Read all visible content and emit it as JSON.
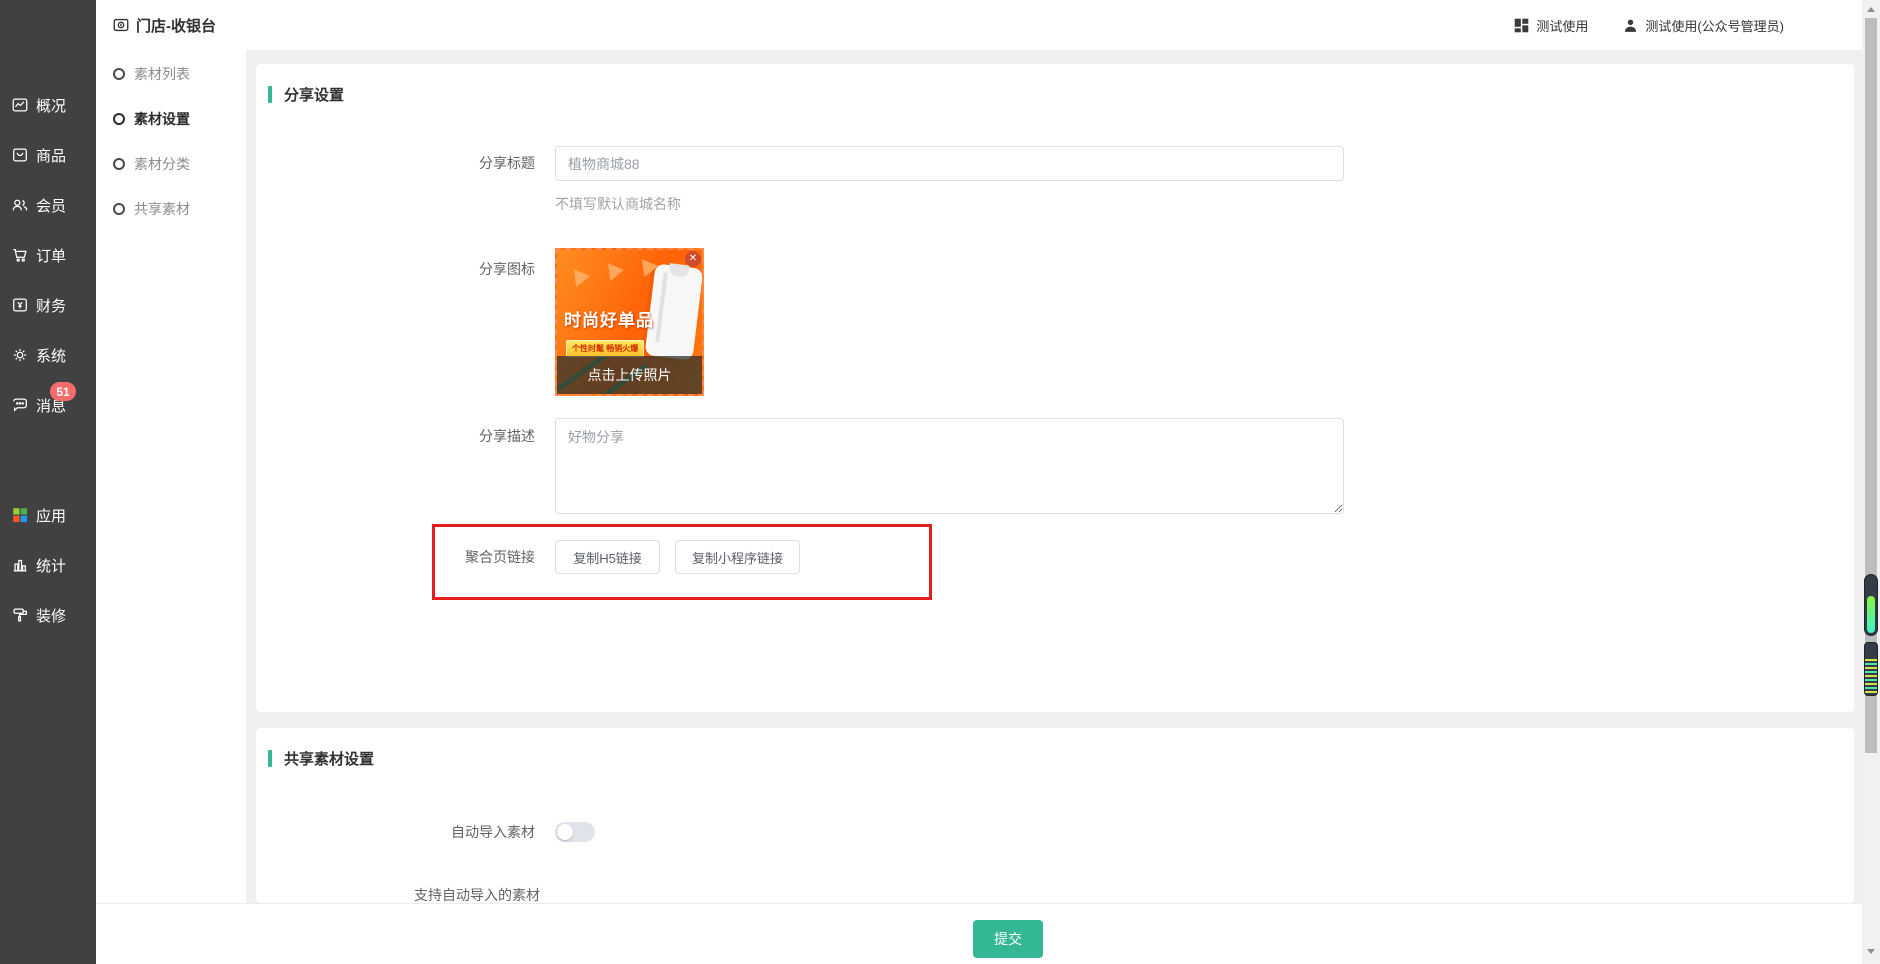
{
  "header": {
    "title": "门店-收银台",
    "actions": [
      {
        "label": "测试使用"
      },
      {
        "label": "测试使用(公众号管理员)"
      }
    ]
  },
  "sidebar": {
    "items": [
      {
        "label": "概况"
      },
      {
        "label": "商品"
      },
      {
        "label": "会员"
      },
      {
        "label": "订单"
      },
      {
        "label": "财务"
      },
      {
        "label": "系统"
      },
      {
        "label": "消息",
        "badge": "51"
      },
      {
        "label": "应用"
      },
      {
        "label": "统计"
      },
      {
        "label": "装修"
      }
    ]
  },
  "submenu": {
    "items": [
      {
        "label": "素材列表",
        "active": false
      },
      {
        "label": "素材设置",
        "active": true
      },
      {
        "label": "素材分类",
        "active": false
      },
      {
        "label": "共享素材",
        "active": false
      }
    ]
  },
  "share_settings": {
    "section_title": "分享设置",
    "share_title": {
      "label": "分享标题",
      "value": "植物商城88",
      "hint": "不填写默认商城名称"
    },
    "share_icon": {
      "label": "分享图标",
      "image_headline": "时尚好单品",
      "image_banner": "个性时髦 畅销火爆",
      "upload_text": "点击上传照片",
      "close_glyph": "✕"
    },
    "share_desc": {
      "label": "分享描述",
      "value": "好物分享"
    },
    "aggregate_link": {
      "label": "聚合页链接",
      "copy_h5_label": "复制H5链接",
      "copy_mini_label": "复制小程序链接"
    }
  },
  "shared_material": {
    "section_title": "共享素材设置",
    "auto_import": {
      "label": "自动导入素材",
      "enabled": false
    },
    "support_label": "支持自动导入的素材"
  },
  "footer": {
    "submit_label": "提交"
  },
  "colors": {
    "accent_teal": "#33b795",
    "badge_red": "#f56c6c",
    "highlight_red": "#e61d1d",
    "sidebar_dark": "#414141",
    "image_orange": "#ff6207"
  }
}
